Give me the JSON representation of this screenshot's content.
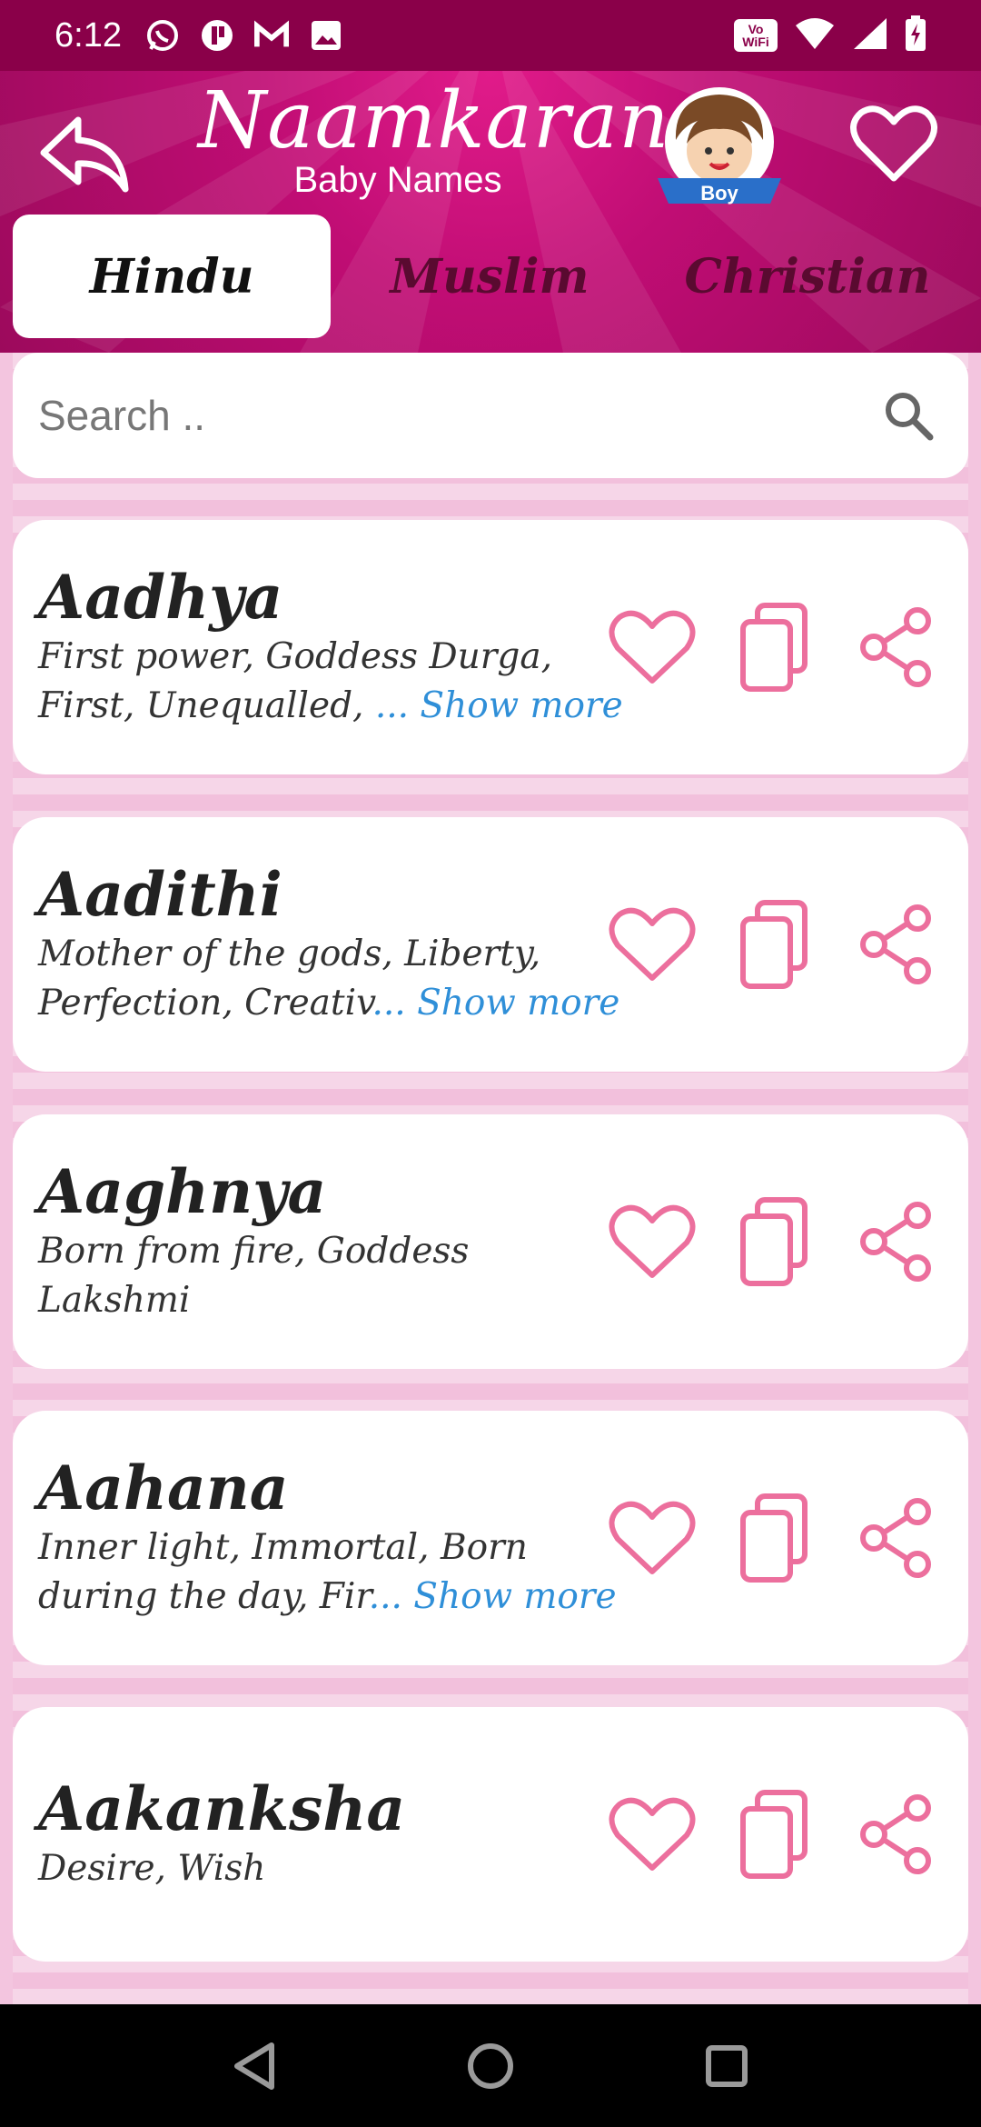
{
  "status_bar": {
    "time": "6:12",
    "left_icons": [
      "whatsapp-icon",
      "app-icon",
      "gmail-icon",
      "gallery-icon"
    ],
    "right_icons": [
      "vowifi-icon",
      "wifi-icon",
      "signal-icon",
      "battery-icon"
    ],
    "vowifi_label": "Vo WiFi"
  },
  "header": {
    "title": "Naamkaran",
    "subtitle": "Baby Names",
    "avatar_badge": "Boy"
  },
  "tabs": [
    {
      "label": "Hindu",
      "active": true
    },
    {
      "label": "Muslim",
      "active": false
    },
    {
      "label": "Christian",
      "active": false
    }
  ],
  "search": {
    "placeholder": "Search .."
  },
  "names": [
    {
      "name": "Aadhya",
      "meaning_line1": "First power, Goddess Durga,",
      "meaning_line2": "First, Unequalled, ",
      "show_more": "... Show more"
    },
    {
      "name": "Aadithi",
      "meaning_line1": "Mother of the gods, Liberty,",
      "meaning_line2": "Perfection, Creativ",
      "show_more": "... Show more"
    },
    {
      "name": "Aaghnya",
      "meaning_line1": "Born from fire, Goddess Lakshmi",
      "meaning_line2": "",
      "show_more": ""
    },
    {
      "name": "Aahana",
      "meaning_line1": "Inner light, Immortal, Born",
      "meaning_line2": "during the day, Fir",
      "show_more": "... Show more"
    },
    {
      "name": "Aakanksha",
      "meaning_line1": "Desire, Wish",
      "meaning_line2": "",
      "show_more": ""
    }
  ],
  "colors": {
    "brand_pink": "#c00d74",
    "icon_pink": "#ec6f9d",
    "link_blue": "#2f8fd8"
  }
}
